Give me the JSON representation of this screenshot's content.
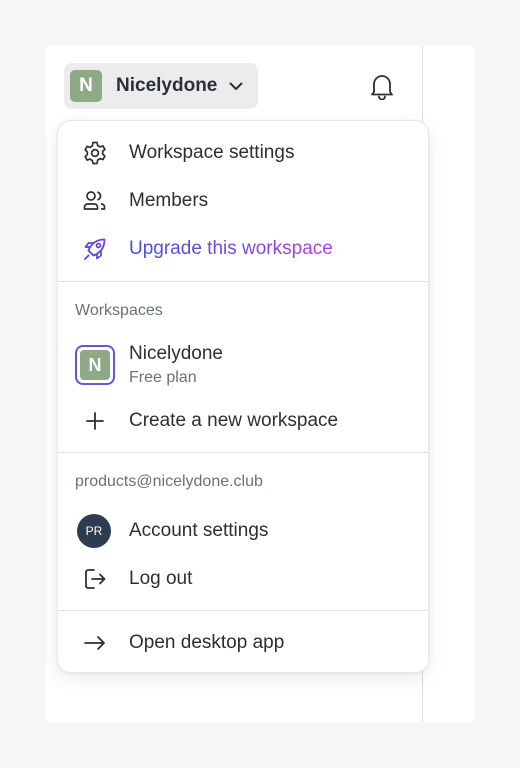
{
  "header": {
    "workspace_initial": "N",
    "workspace_name": "Nicelydone",
    "chevron_icon": "chevron-down-icon",
    "bell_icon": "bell-icon"
  },
  "menu": {
    "top_items": [
      {
        "label": "Workspace settings",
        "icon": "gear-icon"
      },
      {
        "label": "Members",
        "icon": "members-icon"
      },
      {
        "label": "Upgrade this workspace",
        "icon": "rocket-icon"
      }
    ],
    "workspaces": {
      "section_label": "Workspaces",
      "current": {
        "initial": "N",
        "name": "Nicelydone",
        "plan": "Free plan"
      },
      "create_label": "Create a new workspace",
      "create_icon": "plus-icon"
    },
    "account": {
      "email": "products@nicelydone.club",
      "avatar_initials": "PR",
      "settings_label": "Account settings",
      "logout_label": "Log out",
      "logout_icon": "logout-icon"
    },
    "desktop": {
      "label": "Open desktop app",
      "icon": "arrow-right-icon"
    }
  },
  "colors": {
    "upgrade_gradient": [
      "#3b4fe0",
      "#b13fe0"
    ],
    "workspace_green": "#8ea983",
    "selected_border": "#6b52e0"
  }
}
